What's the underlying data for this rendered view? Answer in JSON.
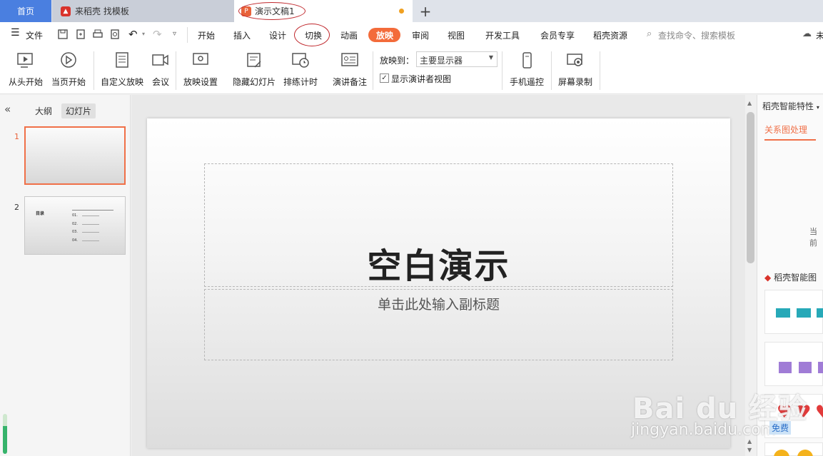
{
  "tabs": {
    "home": "首页",
    "template": "来稻壳 找模板",
    "document": "演示文稿1",
    "new_tab": "+"
  },
  "menu": {
    "file": "文件",
    "items": [
      "开始",
      "插入",
      "设计",
      "切换",
      "动画",
      "放映",
      "审阅",
      "视图",
      "开发工具",
      "会员专享",
      "稻壳资源"
    ],
    "active": "放映",
    "search_placeholder": "查找命令、搜索模板",
    "cloud_label": "未"
  },
  "ribbon": {
    "from_start": "从头开始",
    "current_page": "当页开始",
    "custom_show": "自定义放映",
    "meeting": "会议",
    "show_settings": "放映设置",
    "hide_slide": "隐藏幻灯片",
    "rehearse": "排练计时",
    "speaker_notes": "演讲备注",
    "show_to_label": "放映到：",
    "show_to_value": "主要显示器",
    "presenter_view": "显示演讲者视图",
    "presenter_view_checked": true,
    "phone_remote": "手机遥控",
    "screen_record": "屏幕录制"
  },
  "left_panel": {
    "collapse": "«",
    "tab_outline": "大纲",
    "tab_slides": "幻灯片",
    "slides": [
      {
        "number": "1"
      },
      {
        "number": "2",
        "title": "目录",
        "items": [
          "01.",
          "02.",
          "03.",
          "04."
        ]
      }
    ]
  },
  "slide": {
    "title": "空白演示",
    "subtitle": "单击此处输入副标题"
  },
  "right_panel": {
    "header": "稻壳智能特性",
    "tab": "关系图处理",
    "clipped_text": "当前",
    "section": "稻壳智能图"
  },
  "watermark": {
    "brand": "Bai du 经验",
    "url": "jingyan.baidu.com",
    "badge": "免费"
  },
  "colors": {
    "accent": "#f36b3a",
    "home_tab": "#4a7fe0",
    "annotation": "#c0282d"
  }
}
